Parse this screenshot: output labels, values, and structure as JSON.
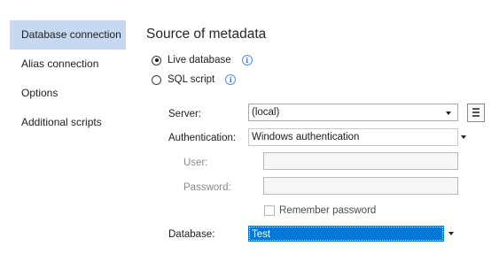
{
  "nav": {
    "items": [
      {
        "label": "Database connection"
      },
      {
        "label": "Alias connection"
      },
      {
        "label": "Options"
      },
      {
        "label": "Additional scripts"
      }
    ]
  },
  "section": {
    "title": "Source of metadata"
  },
  "source": {
    "live_label": "Live database",
    "sql_label": "SQL script",
    "selected": "Live database",
    "info_icon": "i"
  },
  "form": {
    "server_label": "Server:",
    "server_value": "(local)",
    "auth_label": "Authentication:",
    "auth_value": "Windows authentication",
    "user_label": "User:",
    "user_value": "",
    "password_label": "Password:",
    "password_value": "",
    "remember_label": "Remember password",
    "remember_checked": false,
    "database_label": "Database:",
    "database_value": "Test"
  },
  "colors": {
    "nav_active": "#c6d9f1",
    "selection": "#0078d7",
    "info": "#3f7fcf"
  },
  "icons": [
    "info-icon",
    "server-browse-icon",
    "dropdown-arrow-icon"
  ]
}
